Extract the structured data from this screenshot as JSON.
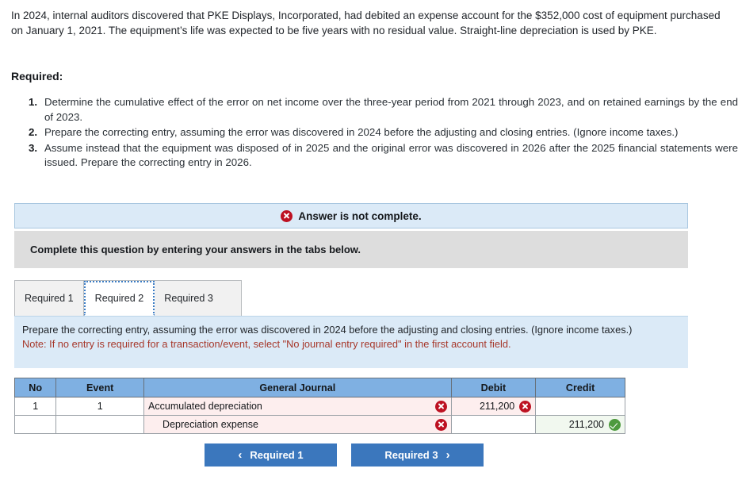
{
  "problem": {
    "text": "In 2024, internal auditors discovered that PKE Displays, Incorporated, had debited an expense account for the $352,000 cost of equipment purchased on January 1, 2021. The equipment’s life was expected to be five years with no residual value. Straight-line depreciation is used by PKE."
  },
  "required": {
    "heading": "Required:",
    "items": [
      {
        "number": "1.",
        "text": "Determine the cumulative effect of the error on net income over the three-year period from 2021 through 2023, and on retained earnings by the end of 2023."
      },
      {
        "number": "2.",
        "text": "Prepare the correcting entry, assuming the error was discovered in 2024 before the adjusting and closing entries. (Ignore income taxes.)"
      },
      {
        "number": "3.",
        "text": "Assume instead that the equipment was disposed of in 2025 and the original error was discovered in 2026 after the 2025 financial statements were issued. Prepare the correcting entry in 2026."
      }
    ]
  },
  "alert": {
    "icon": "x-circle-red-icon",
    "message": "Answer is not complete."
  },
  "instruction_strip": {
    "text": "Complete this question by entering your answers in the tabs below."
  },
  "tabs": [
    {
      "label": "Required 1",
      "active": false
    },
    {
      "label": "Required 2",
      "active": true
    },
    {
      "label": "Required 3",
      "active": false
    }
  ],
  "panel": {
    "instruction": "Prepare the correcting entry, assuming the error was discovered in 2024 before the adjusting and closing entries. (Ignore income taxes.)",
    "note": "Note: If no entry is required for a transaction/event, select \"No journal entry required\" in the first account field."
  },
  "journal": {
    "headers": [
      "No",
      "Event",
      "General Journal",
      "Debit",
      "Credit"
    ],
    "rows": [
      {
        "no": "1",
        "event": "1",
        "account": "Accumulated depreciation",
        "account_indent": false,
        "account_status": "incorrect",
        "debit": "211,200",
        "debit_status": "incorrect",
        "credit": "",
        "credit_status": "none"
      },
      {
        "no": "",
        "event": "",
        "account": "Depreciation expense",
        "account_indent": true,
        "account_status": "incorrect",
        "debit": "",
        "debit_status": "none",
        "credit": "211,200",
        "credit_status": "correct"
      }
    ]
  },
  "nav": {
    "prev_label": "Required 1",
    "prev_icon": "chevron-left-icon",
    "next_label": "Required 3",
    "next_icon": "chevron-right-icon"
  },
  "colors": {
    "header_blue": "#7fb0e2",
    "panel_blue": "#dbeaf7",
    "button_blue": "#3b77bd",
    "error_red": "#bd1122",
    "success_green": "#4e9a3e",
    "note_red": "#a6372a",
    "gray_strip": "#dddddd",
    "wrong_cell": "#fdeeee",
    "right_cell": "#f1f8ef"
  }
}
